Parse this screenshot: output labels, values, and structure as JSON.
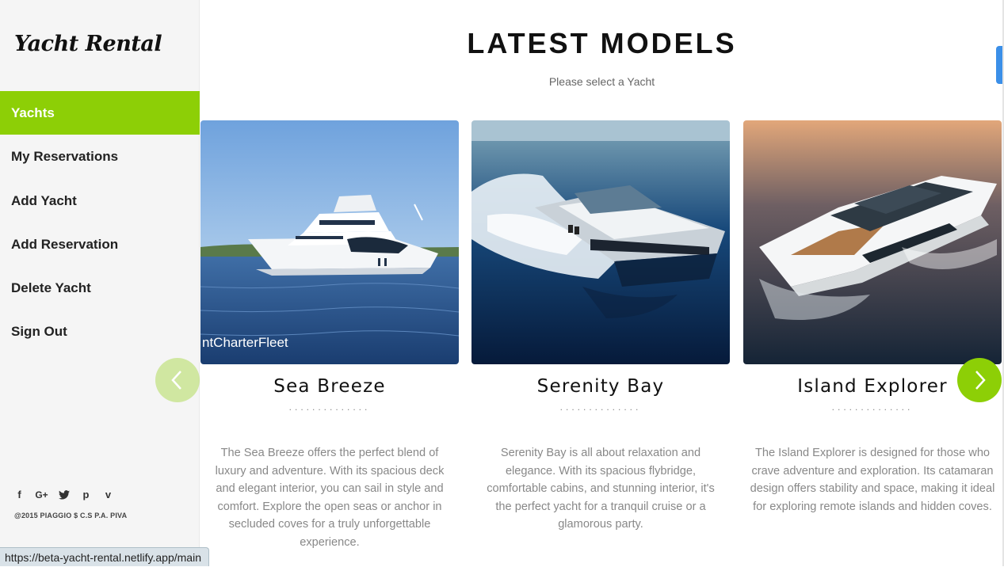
{
  "sidebar": {
    "logo": "Yacht Rental",
    "nav": [
      "Yachts",
      "My Reservations",
      "Add Yacht",
      "Add Reservation",
      "Delete Yacht",
      "Sign Out"
    ],
    "active_item": "Yachts",
    "social": [
      "facebook-icon",
      "google-plus-icon",
      "twitter-icon",
      "pinterest-icon",
      "vimeo-icon"
    ],
    "copyright": "@2015 PIAGGIO $ C.S P.A. PIVA"
  },
  "main": {
    "title": "LATEST MODELS",
    "subtitle": "Please select a Yacht",
    "yachts": [
      {
        "name": "Sea Breeze",
        "dots": "..............",
        "description": "The Sea Breeze offers the perfect blend of luxury and adventure. With its spacious deck and elegant interior, you can sail in style and comfort. Explore the open seas or anchor in secluded coves for a truly unforgettable experience.",
        "watermark": "ntCharterFleet"
      },
      {
        "name": "Serenity Bay",
        "dots": "..............",
        "description": "Serenity Bay is all about relaxation and elegance. With its spacious flybridge, comfortable cabins, and stunning interior, it's the perfect yacht for a tranquil cruise or a glamorous party."
      },
      {
        "name": "Island Explorer",
        "dots": "..............",
        "description": "The Island Explorer is designed for those who crave adventure and exploration. Its catamaran design offers stability and space, making it ideal for exploring remote islands and hidden coves."
      }
    ],
    "prev_icon": "chevron-left-icon",
    "next_icon": "chevron-right-icon"
  },
  "statusbar": {
    "url": "https://beta-yacht-rental.netlify.app/main"
  },
  "colors": {
    "accent": "#8dcf06",
    "sidebar_bg": "#f5f5f5",
    "text_muted": "#888888"
  }
}
